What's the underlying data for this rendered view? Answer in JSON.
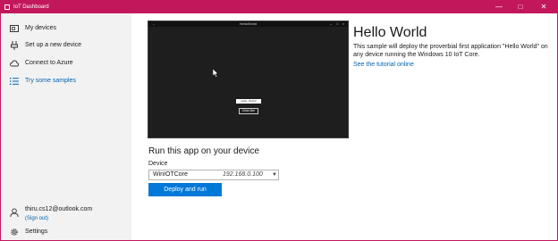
{
  "window": {
    "title": "IoT Dashboard",
    "accent": "#c2185b"
  },
  "sidebar": {
    "items": [
      {
        "label": "My devices",
        "icon": "devices-icon"
      },
      {
        "label": "Set up a new device",
        "icon": "setup-icon"
      },
      {
        "label": "Connect to Azure",
        "icon": "cloud-icon"
      },
      {
        "label": "Try some samples",
        "icon": "samples-icon",
        "active": true
      }
    ],
    "account": {
      "email": "thiru.cs12@outlook.com",
      "signout": "(Sign out)"
    },
    "settings_label": "Settings"
  },
  "preview": {
    "window_title": "HelloWorld",
    "textbox_text": "Hello, World!",
    "button_label": "Click Me!"
  },
  "sample": {
    "title": "Hello World",
    "description": "This sample will deploy the proverbial first application \"Hello World\" on any device running the Windows 10 IoT Core.",
    "link": "See the tutorial online"
  },
  "run": {
    "heading": "Run this app on your device",
    "device_label": "Device",
    "device_name": "WinIOTCore",
    "device_ip": "192.168.0.100",
    "deploy_label": "Deploy and run"
  }
}
